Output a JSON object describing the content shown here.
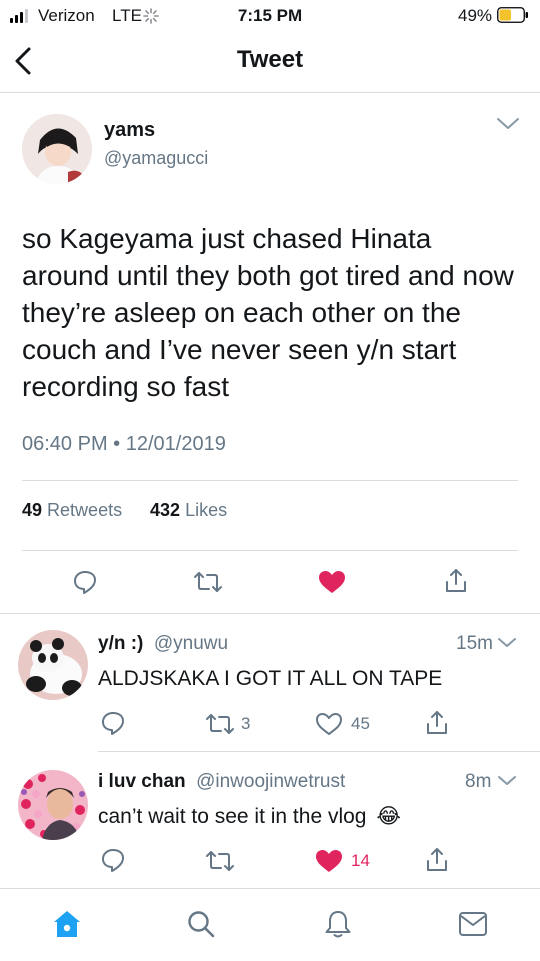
{
  "status_bar": {
    "carrier": "Verizon",
    "network": "LTE",
    "time": "7:15 PM",
    "battery": "49%",
    "battery_level": 0.49,
    "colors": {
      "battery_fill": "#f4c22b"
    }
  },
  "nav": {
    "title": "Tweet",
    "back_icon": "chevron-left-icon"
  },
  "tweet": {
    "name": "yams",
    "handle": "@yamagucci",
    "text": "so Kageyama just chased Hinata around until they both got tired and now they’re asleep on each other on the couch and I’ve never seen y/n start recording so fast",
    "timestamp": "06:40 PM • 12/01/2019",
    "retweets_count": "49",
    "retweets_label": "Retweets",
    "likes_count": "432",
    "likes_label": "Likes",
    "liked": true
  },
  "replies": [
    {
      "name": "y/n :)",
      "handle": "@ynuwu",
      "time": "15m",
      "text": "ALDJSKAKA I GOT IT ALL ON TAPE",
      "retweets": "3",
      "likes": "45",
      "liked": false
    },
    {
      "name": "i luv chan",
      "handle": "@inwoojinwetrust",
      "time": "8m",
      "text": "can’t wait to see it in the vlog",
      "emoji": "😂",
      "likes": "14",
      "liked": true
    }
  ],
  "tab_bar": {
    "items": [
      "home-icon",
      "search-icon",
      "bell-icon",
      "mail-icon"
    ],
    "active": "home-icon"
  },
  "colors": {
    "like_red": "#e0245e",
    "accent_blue": "#1da1f2",
    "secondary_gray": "#657786",
    "divider": "#d9dde1"
  }
}
